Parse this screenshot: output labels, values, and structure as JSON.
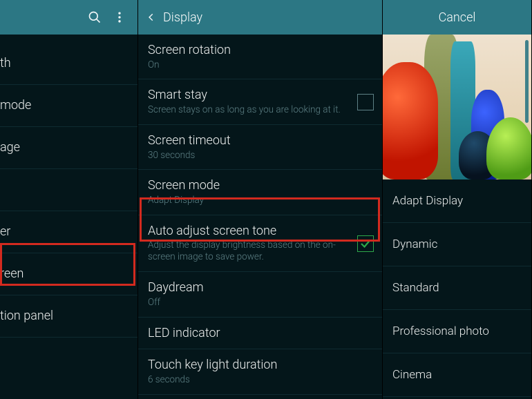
{
  "panel_a": {
    "items": [
      {
        "label": "th"
      },
      {
        "label": "mode"
      },
      {
        "label": "age"
      },
      {
        "label": ""
      },
      {
        "label": "er"
      },
      {
        "label": "reen"
      },
      {
        "label": "tion panel"
      }
    ]
  },
  "panel_b": {
    "title": "Display",
    "items": [
      {
        "title": "Screen rotation",
        "sub": "On"
      },
      {
        "title": "Smart stay",
        "sub": "Screen stays on as long as you are looking at it.",
        "checkbox": "unchecked"
      },
      {
        "title": "Screen timeout",
        "sub": "30 seconds"
      },
      {
        "title": "Screen mode",
        "sub": "Adapt Display"
      },
      {
        "title": "Auto adjust screen tone",
        "sub": "Adjust the display brightness based on the on-screen image to save power.",
        "checkbox": "checked"
      },
      {
        "title": "Daydream",
        "sub": "Off"
      },
      {
        "title": "LED indicator",
        "sub": ""
      },
      {
        "title": "Touch key light duration",
        "sub": "6 seconds"
      }
    ]
  },
  "panel_c": {
    "cancel": "Cancel",
    "options": [
      {
        "label": "Adapt Display"
      },
      {
        "label": "Dynamic"
      },
      {
        "label": "Standard"
      },
      {
        "label": "Professional photo"
      },
      {
        "label": "Cinema"
      }
    ]
  }
}
